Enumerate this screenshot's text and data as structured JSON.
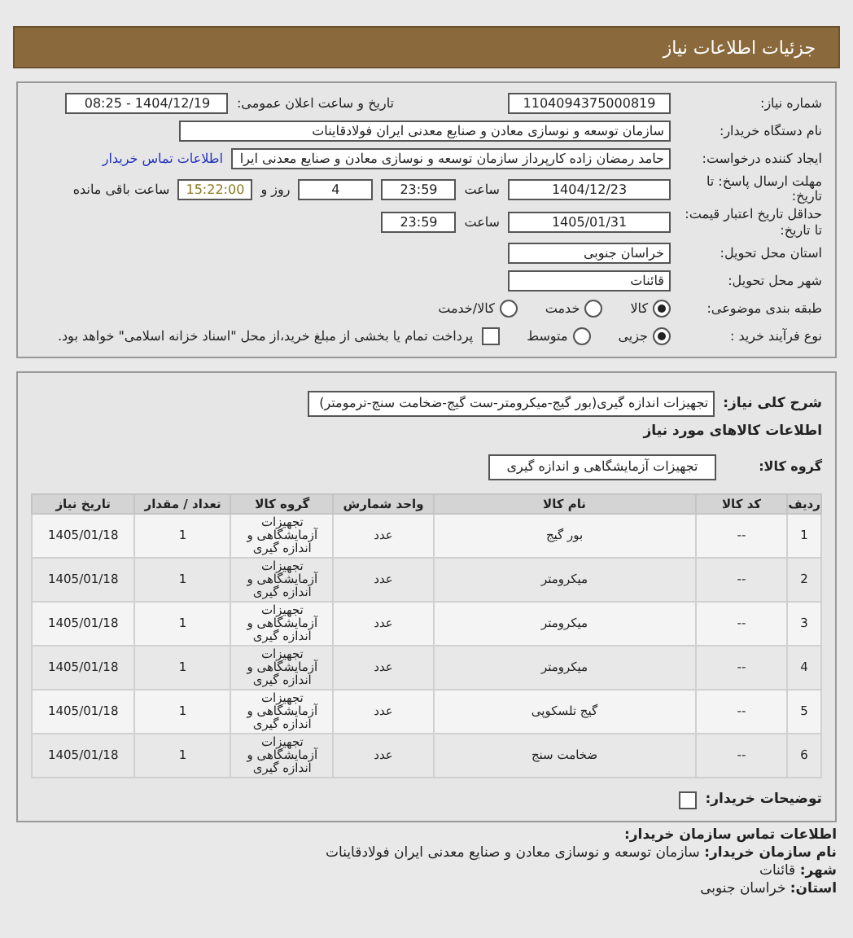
{
  "header": {
    "title": "جزئیات اطلاعات نیاز"
  },
  "need_number": {
    "label": "شماره نیاز:",
    "value": "1104094375000819"
  },
  "announce": {
    "label": "تاریخ و ساعت اعلان عمومی:",
    "value": "1404/12/19 - 08:25"
  },
  "buyer": {
    "label": "نام دستگاه خریدار:",
    "value": "سازمان توسعه و نوسازی معادن و صنایع معدنی ایران فولادقاینات"
  },
  "creator": {
    "label": "ایجاد کننده درخواست:",
    "value": "حامد  رمضان زاده  کارپرداز  سازمان توسعه و نوسازی معادن و صنایع معدنی ایرا",
    "link": "اطلاعات تماس خریدار"
  },
  "deadline": {
    "label": "مهلت ارسال پاسخ: تا تاریخ:",
    "date": "1404/12/23",
    "time_label": "ساعت",
    "time": "23:59",
    "days": "4",
    "days_label": "روز و",
    "remaining": "15:22:00",
    "remaining_label": "ساعت باقی مانده"
  },
  "validity": {
    "label": "حداقل تاریخ اعتبار قیمت: تا تاریخ:",
    "date": "1405/01/31",
    "time_label": "ساعت",
    "time": "23:59"
  },
  "province": {
    "label": "استان محل تحویل:",
    "value": "خراسان جنوبی"
  },
  "city": {
    "label": "شهر محل تحویل:",
    "value": "قائنات"
  },
  "category": {
    "label": "طبقه بندی موضوعی:",
    "options": [
      {
        "label": "کالا",
        "selected": true
      },
      {
        "label": "خدمت",
        "selected": false
      },
      {
        "label": "کالا/خدمت",
        "selected": false
      }
    ]
  },
  "process": {
    "label": "نوع فرآیند خرید :",
    "options": [
      {
        "label": "جزیی",
        "selected": true
      },
      {
        "label": "متوسط",
        "selected": false
      }
    ],
    "treasury": {
      "checked": false,
      "label": "پرداخت تمام یا بخشی از مبلغ خرید،از محل \"اسناد خزانه اسلامی\" خواهد بود."
    }
  },
  "description": {
    "label": "شرح کلی نیاز:",
    "value": "تجهیزات اندازه گیری(بور گیج-میکرومتر-ست گیج-ضخامت سنج-ترمومتر)"
  },
  "goods_heading": "اطلاعات کالاهای مورد نیاز",
  "goods_group": {
    "label": "گروه کالا:",
    "value": "تجهیزات آزمایشگاهی و اندازه گیری"
  },
  "table": {
    "columns": [
      "ردیف",
      "کد کالا",
      "نام کالا",
      "واحد شمارش",
      "گروه کالا",
      "تعداد / مقدار",
      "تاریخ نیاز"
    ],
    "rows": [
      [
        "1",
        "--",
        "بور گیج",
        "عدد",
        "تجهیزات آزمایشگاهی و اندازه گیری",
        "1",
        "1405/01/18"
      ],
      [
        "2",
        "--",
        "میکرومتر",
        "عدد",
        "تجهیزات آزمایشگاهی و اندازه گیری",
        "1",
        "1405/01/18"
      ],
      [
        "3",
        "--",
        "میکرومتر",
        "عدد",
        "تجهیزات آزمایشگاهی و اندازه گیری",
        "1",
        "1405/01/18"
      ],
      [
        "4",
        "--",
        "میکرومتر",
        "عدد",
        "تجهیزات آزمایشگاهی و اندازه گیری",
        "1",
        "1405/01/18"
      ],
      [
        "5",
        "--",
        "گیج تلسکوپی",
        "عدد",
        "تجهیزات آزمایشگاهی و اندازه گیری",
        "1",
        "1405/01/18"
      ],
      [
        "6",
        "--",
        "ضخامت سنج",
        "عدد",
        "تجهیزات آزمایشگاهی و اندازه گیری",
        "1",
        "1405/01/18"
      ]
    ]
  },
  "buyer_notes": {
    "label": "توضیحات خریدار:",
    "checked": false
  },
  "contact": {
    "title": "اطلاعات تماس سازمان خریدار:",
    "lines": [
      {
        "label": "نام سازمان خریدار:",
        "value": "سازمان توسعه و نوسازی معادن و صنایع معدنی ایران فولادقاینات"
      },
      {
        "label": "شهر:",
        "value": "قائنات"
      },
      {
        "label": "استان:",
        "value": "خراسان جنوبی"
      }
    ]
  }
}
